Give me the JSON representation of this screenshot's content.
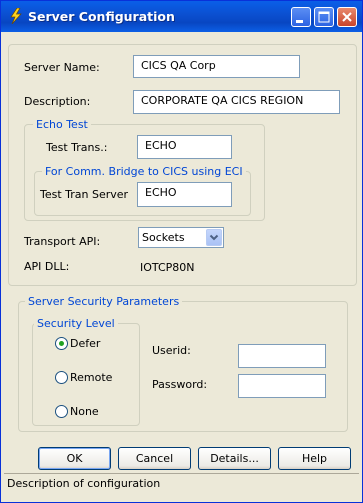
{
  "window": {
    "title": "Server Configuration",
    "icon": "lightning-bolt-icon"
  },
  "form": {
    "server_name_label": "Server Name:",
    "server_name_value": "CICS QA Corp",
    "description_label": "Description:",
    "description_value": "CORPORATE QA CICS REGION",
    "echo_test": {
      "legend": "Echo Test",
      "test_trans_label": "Test Trans.:",
      "test_trans_value": "ECHO",
      "comm_bridge": {
        "legend": "For Comm. Bridge to CICS using  ECI",
        "test_tran_server_label": "Test Tran Server",
        "test_tran_server_value": "ECHO"
      }
    },
    "transport_api_label": "Transport API:",
    "transport_api_value": "Sockets",
    "api_dll_label": "API DLL:",
    "api_dll_value": "IOTCP80N"
  },
  "security": {
    "legend": "Server Security Parameters",
    "level_legend": "Security Level",
    "options": [
      {
        "label": "Defer",
        "selected": true
      },
      {
        "label": "Remote",
        "selected": false
      },
      {
        "label": "None",
        "selected": false
      }
    ],
    "userid_label": "Userid:",
    "userid_value": "",
    "password_label": "Password:",
    "password_value": ""
  },
  "buttons": {
    "ok": "OK",
    "cancel": "Cancel",
    "details": "Details...",
    "help": "Help"
  },
  "status": {
    "text": "Description of configuration"
  }
}
